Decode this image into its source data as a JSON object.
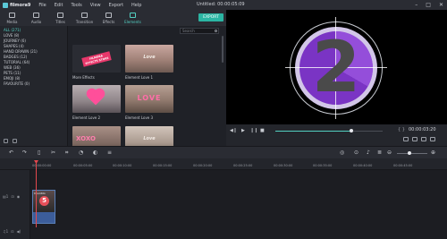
{
  "app": {
    "name": "filmora9",
    "menu": [
      "File",
      "Edit",
      "Tools",
      "View",
      "Export",
      "Help"
    ],
    "document_title": "Untitled:",
    "document_time": "00:00:05:09"
  },
  "tabs": [
    {
      "label": "Media",
      "icon": "folder-icon"
    },
    {
      "label": "Audio",
      "icon": "music-icon"
    },
    {
      "label": "Titles",
      "icon": "text-icon"
    },
    {
      "label": "Transition",
      "icon": "transition-icon"
    },
    {
      "label": "Effects",
      "icon": "effects-icon"
    },
    {
      "label": "Elements",
      "icon": "elements-icon",
      "active": true
    }
  ],
  "export_label": "EXPORT",
  "categories": [
    "ALL (271)",
    "LOVE (8)",
    "JOURNEY (6)",
    "SHAPES (4)",
    "HAND DRAWN (21)",
    "BADGES (12)",
    "TUTORIAL (64)",
    "WEB (36)",
    "PETS (11)",
    "EMOJI (8)",
    "FAVOURITE (0)"
  ],
  "search": {
    "placeholder": "Search"
  },
  "elements": [
    {
      "label": "More Effects",
      "overlay": "FILMORA EFFECTS STORE"
    },
    {
      "label": "Element Love 1",
      "overlay": "Love"
    },
    {
      "label": "Element Love 2",
      "overlay": ""
    },
    {
      "label": "Element Love 3",
      "overlay": "LOVE"
    },
    {
      "label": "",
      "overlay": "XOXO"
    },
    {
      "label": "",
      "overlay": "Love"
    }
  ],
  "preview": {
    "countdown_number": "2"
  },
  "player": {
    "time": "00:00:03:20",
    "braces": "{ }",
    "progress": 0.71
  },
  "timeline": {
    "ruler_labels": [
      "00:00:00:00",
      "00:00:05:00",
      "00:00:10:00",
      "00:00:15:00",
      "00:00:20:00",
      "00:00:25:00",
      "00:00:30:00",
      "00:00:35:00",
      "00:00:40:00",
      "00:00:45:00"
    ],
    "zoom_level": 0.41,
    "clip_name": "Countdo",
    "clip_number": "5"
  },
  "colors": {
    "accent": "#53d0c2",
    "export": "#2bb5a3",
    "playhead": "#e4484e",
    "clip": "#3c5d9a"
  }
}
